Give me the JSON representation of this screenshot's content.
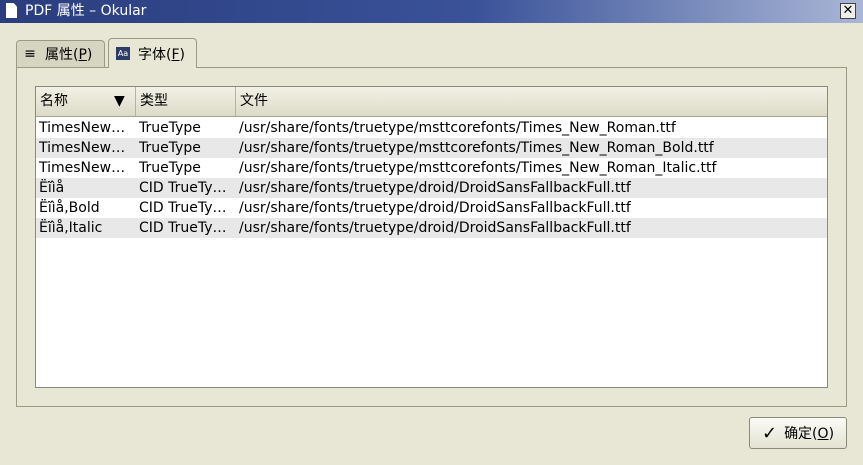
{
  "window": {
    "title": "PDF 属性 – Okular",
    "close_glyph": "✕"
  },
  "tabs": [
    {
      "icon": "list-icon",
      "label": "属性(",
      "mnemonic": "P",
      "suffix": ")"
    },
    {
      "icon": "font-icon",
      "icon_text": "Aa",
      "label": "字体(",
      "mnemonic": "F",
      "suffix": ")"
    }
  ],
  "fonts_table": {
    "columns": [
      "名称",
      "类型",
      "文件"
    ],
    "sort_glyph": "▼",
    "rows": [
      {
        "name": "TimesNew…",
        "type": "TrueType",
        "file": "/usr/share/fonts/truetype/msttcorefonts/Times_New_Roman.ttf"
      },
      {
        "name": "TimesNew…",
        "type": "TrueType",
        "file": "/usr/share/fonts/truetype/msttcorefonts/Times_New_Roman_Bold.ttf"
      },
      {
        "name": "TimesNew…",
        "type": "TrueType",
        "file": "/usr/share/fonts/truetype/msttcorefonts/Times_New_Roman_Italic.ttf"
      },
      {
        "name": "Ëĩìå",
        "type": "CID TrueTy…",
        "file": "/usr/share/fonts/truetype/droid/DroidSansFallbackFull.ttf"
      },
      {
        "name": "Ëĩìå,Bold",
        "type": "CID TrueTy…",
        "file": "/usr/share/fonts/truetype/droid/DroidSansFallbackFull.ttf"
      },
      {
        "name": "Ëĩìå,Italic",
        "type": "CID TrueTy…",
        "file": "/usr/share/fonts/truetype/droid/DroidSansFallbackFull.ttf"
      }
    ]
  },
  "ok_button": {
    "check_glyph": "✓",
    "label": "确定(",
    "mnemonic": "O",
    "suffix": ")"
  }
}
